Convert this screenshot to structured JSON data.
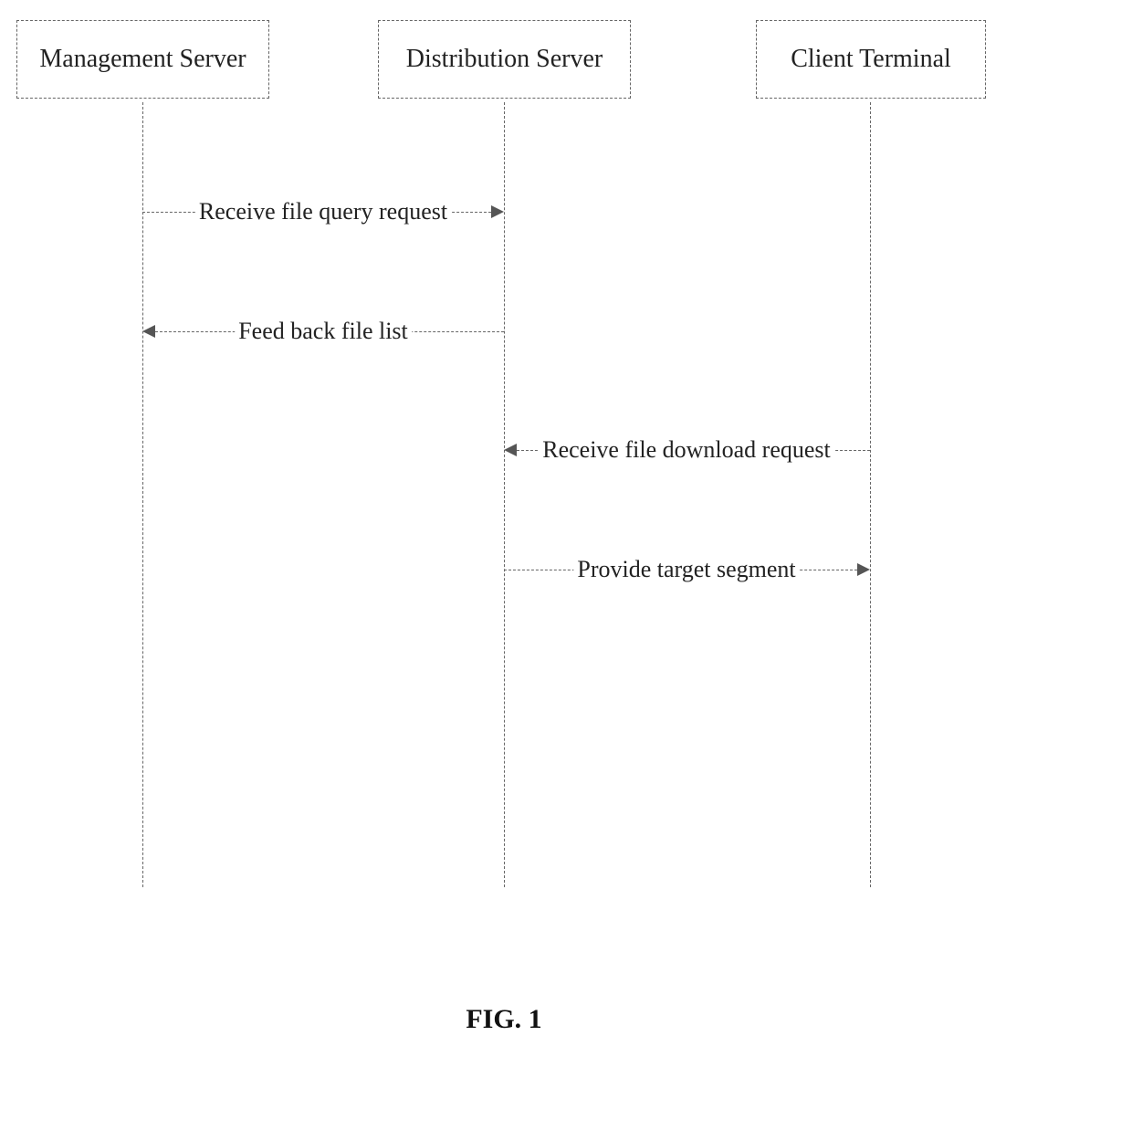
{
  "participants": {
    "management_server": "Management Server",
    "distribution_server": "Distribution Server",
    "client_terminal": "Client Terminal"
  },
  "messages": {
    "m1": "Receive file query request",
    "m2": "Feed back file list",
    "m3": "Receive file download request",
    "m4": "Provide target segment"
  },
  "caption": "FIG. 1"
}
